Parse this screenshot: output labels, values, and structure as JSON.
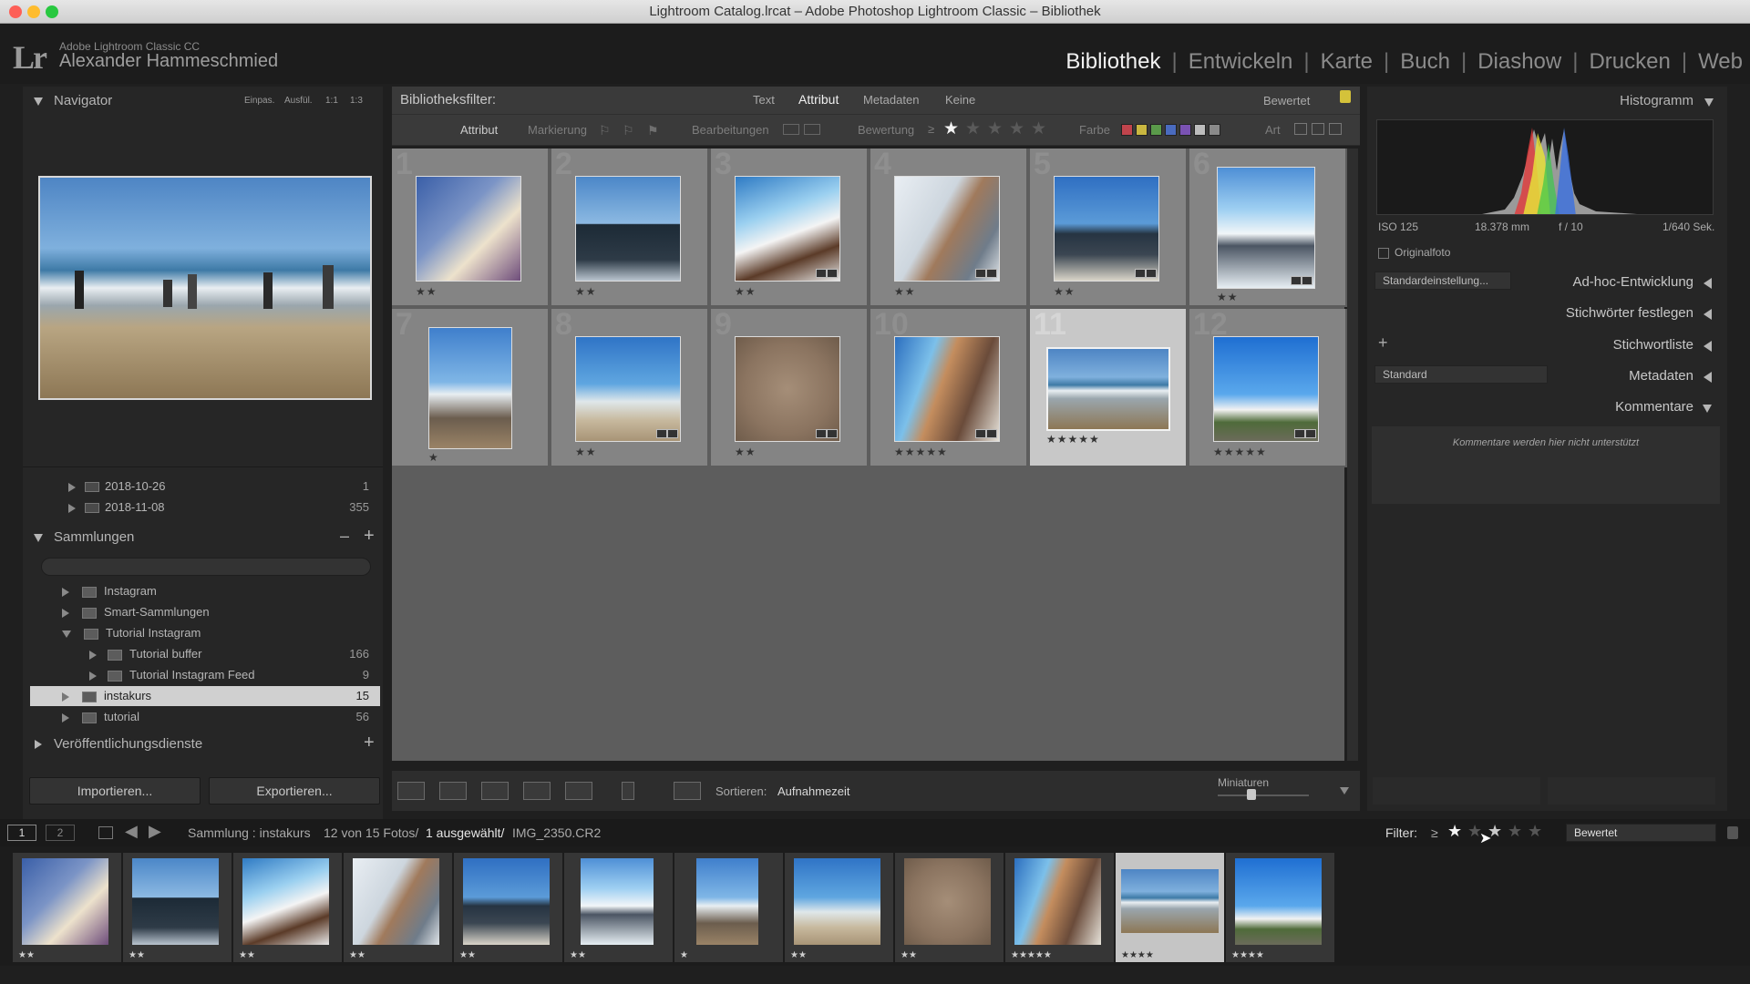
{
  "window": {
    "title": "Lightroom Catalog.lrcat – Adobe Photoshop Lightroom Classic – Bibliothek"
  },
  "identity": {
    "logo": "Lr",
    "app_name": "Adobe Lightroom Classic CC",
    "user_name": "Alexander Hammeschmied"
  },
  "modules": [
    "Bibliothek",
    "Entwickeln",
    "Karte",
    "Buch",
    "Diashow",
    "Drucken",
    "Web"
  ],
  "active_module": "Bibliothek",
  "navigator": {
    "title": "Navigator",
    "zoom": [
      "Einpas.",
      "Ausfül.",
      "1:1",
      "1:3"
    ]
  },
  "folders": [
    {
      "label": "2018-10-26",
      "count": "1"
    },
    {
      "label": "2018-11-08",
      "count": "355"
    }
  ],
  "collections": {
    "title": "Sammlungen",
    "minus": "–",
    "plus": "+",
    "items": [
      {
        "label": "Instagram",
        "count": ""
      },
      {
        "label": "Smart-Sammlungen",
        "count": ""
      },
      {
        "label": "Tutorial Instagram",
        "count": ""
      },
      {
        "label": "Tutorial buffer",
        "count": "166"
      },
      {
        "label": "Tutorial Instagram Feed",
        "count": "9"
      },
      {
        "label": "instakurs",
        "count": "15"
      },
      {
        "label": "tutorial",
        "count": "56"
      }
    ]
  },
  "publish": {
    "title": "Veröffentlichungsdienste",
    "plus": "+"
  },
  "buttons": {
    "import": "Importieren...",
    "export": "Exportieren..."
  },
  "library_filter": {
    "label": "Bibliotheksfilter:",
    "tabs": [
      "Text",
      "Attribut",
      "Metadaten",
      "Keine"
    ],
    "active_tab": "Attribut",
    "preset": "Bewertet",
    "attribut_label": "Attribut",
    "markierung": "Markierung",
    "bearbeitungen": "Bearbeitungen",
    "bewertung": "Bewertung",
    "ge": "≥",
    "farbe": "Farbe",
    "art": "Art",
    "colors": [
      "#c0444c",
      "#c9b740",
      "#5a9a4a",
      "#4a6bbf",
      "#7a52b3",
      "#bdbdbd",
      "#8a8a8a"
    ]
  },
  "grid": {
    "cells": [
      {
        "num": "1",
        "stars": "★★",
        "selected": false
      },
      {
        "num": "2",
        "stars": "★★",
        "selected": false
      },
      {
        "num": "3",
        "stars": "★★",
        "selected": false
      },
      {
        "num": "4",
        "stars": "★★",
        "selected": false
      },
      {
        "num": "5",
        "stars": "★★",
        "selected": false
      },
      {
        "num": "6",
        "stars": "★★",
        "selected": false
      },
      {
        "num": "7",
        "stars": "★",
        "selected": false
      },
      {
        "num": "8",
        "stars": "★★",
        "selected": false
      },
      {
        "num": "9",
        "stars": "★★",
        "selected": false
      },
      {
        "num": "10",
        "stars": "★★★★★",
        "selected": false
      },
      {
        "num": "11",
        "stars": "★★★★★",
        "selected": true
      },
      {
        "num": "12",
        "stars": "★★★★★",
        "selected": false
      }
    ]
  },
  "toolbar": {
    "sort_label": "Sortieren:",
    "sort_value": "Aufnahmezeit",
    "thumbs_label": "Miniaturen"
  },
  "histogram": {
    "title": "Histogramm",
    "iso": "ISO 125",
    "focal": "18.378 mm",
    "aperture": "f / 10",
    "shutter": "1/640 Sek.",
    "original": "Originalfoto"
  },
  "right_panels": {
    "preset": "Standardeinstellung...",
    "adhoc": "Ad-hoc-Entwicklung",
    "keywording": "Stichwörter festlegen",
    "keyword_list": "Stichwortliste",
    "meta_preset": "Standard",
    "metadata": "Metadaten",
    "comments": "Kommentare",
    "comments_msg": "Kommentare werden hier nicht unterstützt",
    "plus": "+"
  },
  "secondary": {
    "views": [
      "1",
      "2"
    ],
    "source": "Sammlung : instakurs",
    "count": "12 von 15 Fotos/",
    "selected": "1 ausgewählt/",
    "file": "IMG_2350.CR2",
    "filter_label": "Filter:",
    "filter_ge": "≥",
    "filter_preset": "Bewertet"
  },
  "filmstrip": {
    "items": [
      {
        "stars": "★★",
        "selected": false
      },
      {
        "stars": "★★",
        "selected": false
      },
      {
        "stars": "★★",
        "selected": false
      },
      {
        "stars": "★★",
        "selected": false
      },
      {
        "stars": "★★",
        "selected": false
      },
      {
        "stars": "★★",
        "selected": false
      },
      {
        "stars": "★",
        "selected": false
      },
      {
        "stars": "★★",
        "selected": false
      },
      {
        "stars": "★★",
        "selected": false
      },
      {
        "stars": "★★★★★",
        "selected": false
      },
      {
        "stars": "★★★★",
        "selected": true
      },
      {
        "stars": "★★★★",
        "selected": false
      }
    ]
  }
}
